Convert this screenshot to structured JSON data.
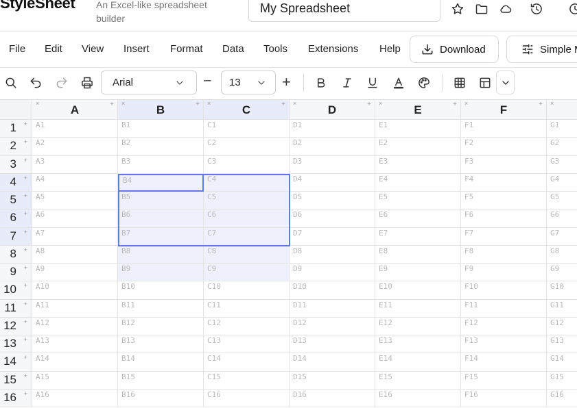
{
  "header": {
    "brand": "StyleSheet",
    "subtitle": "An Excel-like spreadsheet builder",
    "doc_title": "My Spreadsheet"
  },
  "menu": [
    "File",
    "Edit",
    "View",
    "Insert",
    "Format",
    "Data",
    "Tools",
    "Extensions",
    "Help"
  ],
  "buttons": {
    "download": "Download",
    "simple": "Simple Mode"
  },
  "toolbar": {
    "font": "Arial",
    "font_size": "13",
    "minus": "–",
    "plus": "+"
  },
  "grid": {
    "columns": [
      "A",
      "B",
      "C",
      "D",
      "E",
      "F",
      "G"
    ],
    "rows": [
      1,
      2,
      3,
      4,
      5,
      6,
      7,
      8,
      9,
      10,
      11,
      12,
      13,
      14,
      15,
      16
    ],
    "selected_columns": [
      "B",
      "C"
    ],
    "selected_rows": [
      4,
      5,
      6,
      7
    ],
    "active_cell": "B4",
    "highlight_rows": [
      4,
      5,
      6,
      7,
      8,
      9
    ]
  },
  "colors": {
    "accent": "#5b7fd6",
    "selection_fill": "#eef1fc",
    "header_selected": "#e7ebfa"
  }
}
